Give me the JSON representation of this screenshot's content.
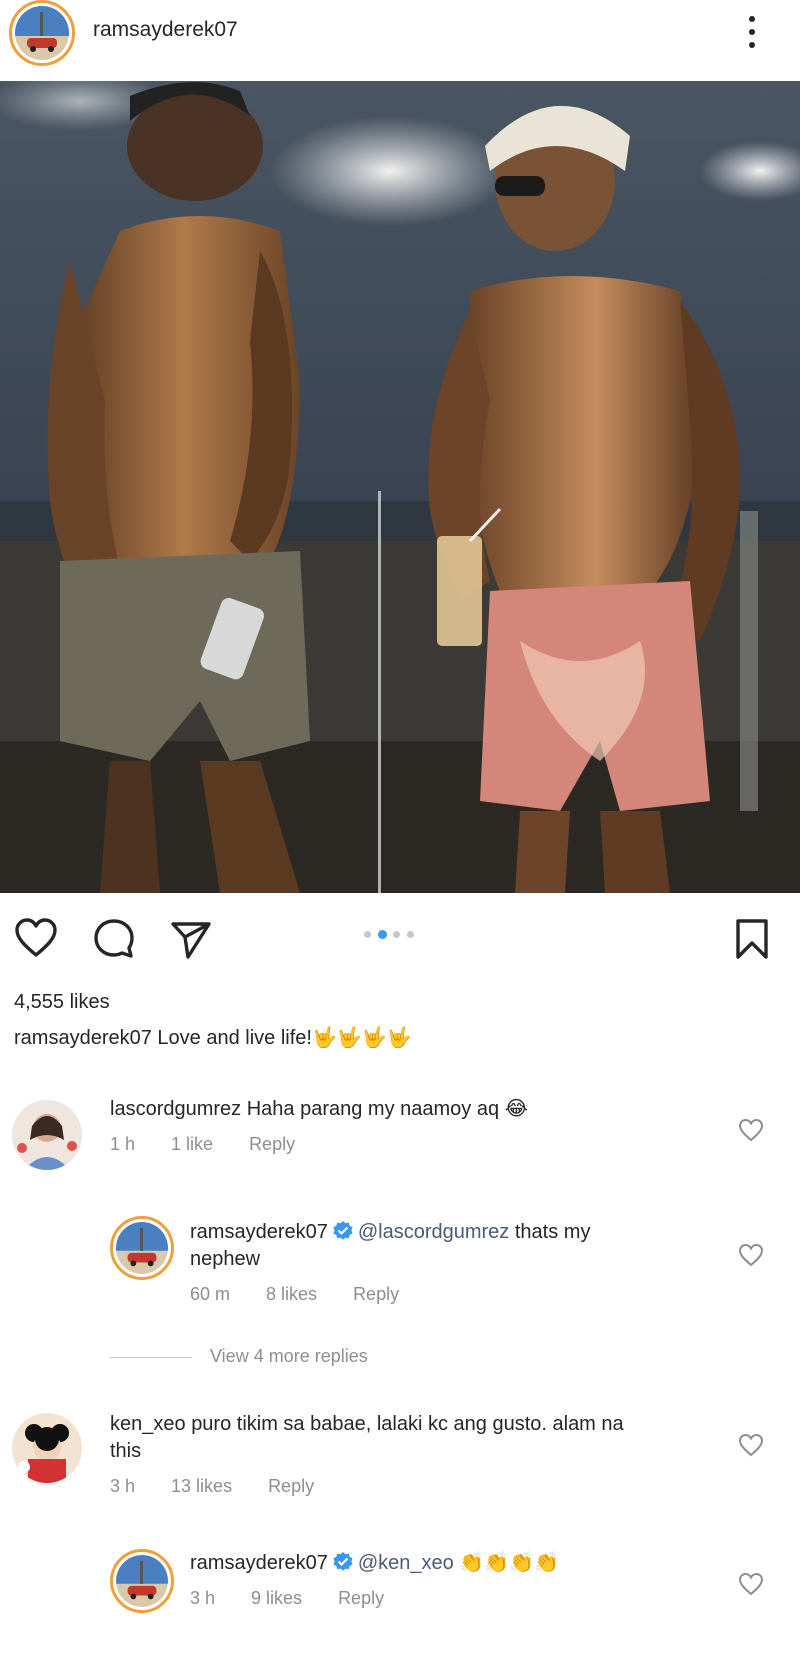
{
  "post": {
    "username": "ramsayderek07",
    "likes": "4,555 likes",
    "caption_user": "ramsayderek07",
    "caption_text": "Love and live life!",
    "caption_emoji": "🤟🤟🤟🤟",
    "carousel_count": 4,
    "carousel_active": 2
  },
  "icons": [
    "heart-icon",
    "comment-icon",
    "share-icon",
    "bookmark-icon",
    "more-icon",
    "verified-icon"
  ],
  "colors": {
    "accent": "#3897f0",
    "muted": "#8e8e8e",
    "ring": "#f0a03a",
    "text": "#262626"
  },
  "comments": [
    {
      "user": "lascordgumrez",
      "text": "Haha parang my naamoy aq 😂",
      "time": "1 h",
      "likes": "1 like",
      "reply": "Reply"
    },
    {
      "user": "ramsayderek07",
      "verified": true,
      "mention": "@lascordgumrez",
      "text": "thats my",
      "text2": "nephew",
      "time": "60 m",
      "likes": "8 likes",
      "reply": "Reply"
    },
    {
      "view_more": "View 4 more replies"
    },
    {
      "user": "ken_xeo",
      "text": "puro tikim sa babae, lalaki kc ang gusto. alam na",
      "text2": "this",
      "time": "3 h",
      "likes": "13 likes",
      "reply": "Reply"
    },
    {
      "user": "ramsayderek07",
      "verified": true,
      "mention": "@ken_xeo",
      "text": "👏👏👏👏",
      "time": "3 h",
      "likes": "9 likes",
      "reply": "Reply"
    }
  ]
}
